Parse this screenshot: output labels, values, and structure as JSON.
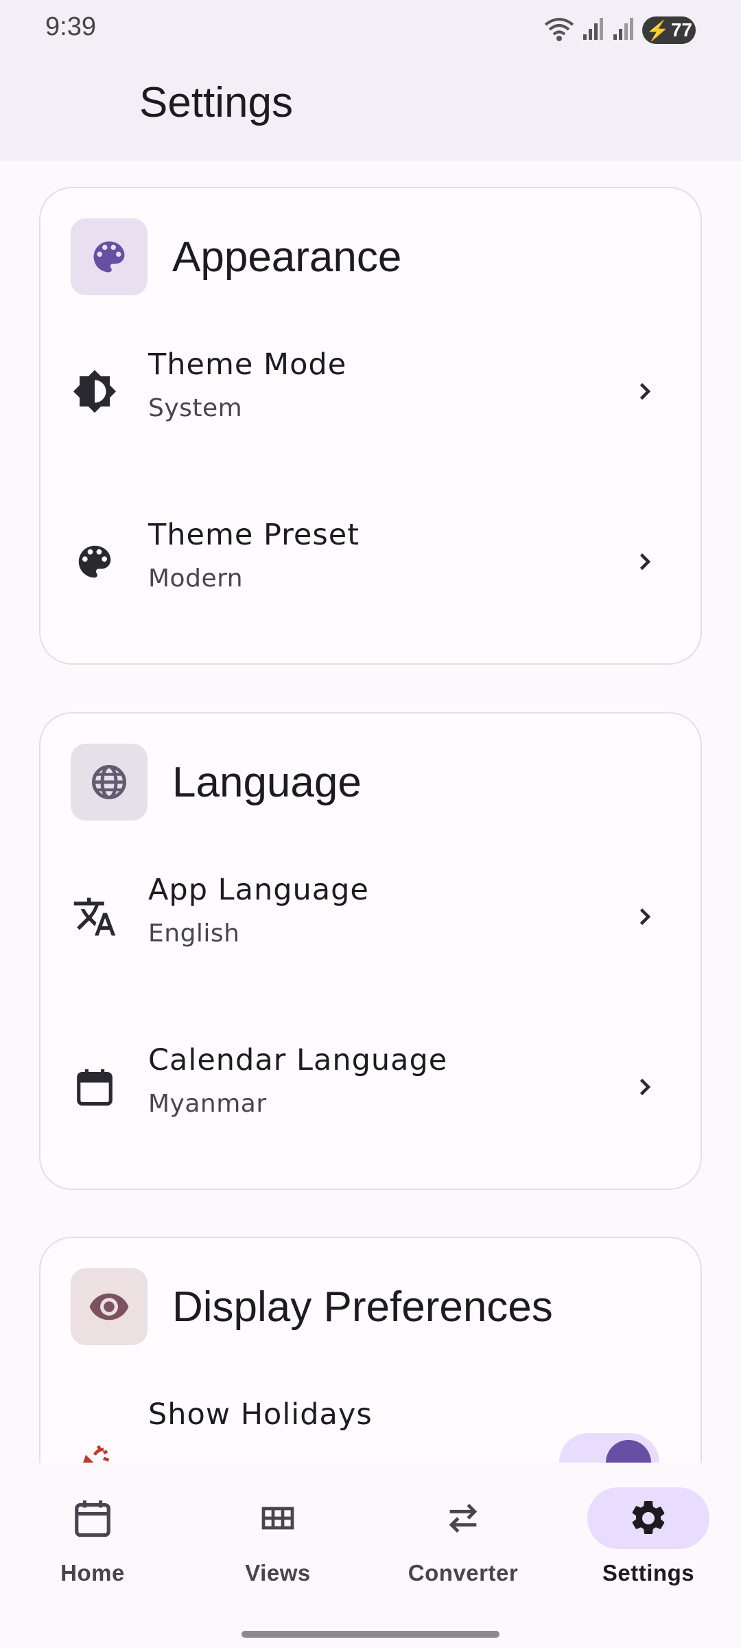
{
  "status": {
    "time": "9:39",
    "battery": "77"
  },
  "appbar": {
    "title": "Settings"
  },
  "sections": {
    "appearance": {
      "title": "Appearance",
      "icon": "palette-icon",
      "items": [
        {
          "title": "Theme Mode",
          "value": "System",
          "icon": "brightness-icon"
        },
        {
          "title": "Theme Preset",
          "value": "Modern",
          "icon": "palette-icon"
        }
      ]
    },
    "language": {
      "title": "Language",
      "icon": "globe-icon",
      "items": [
        {
          "title": "App Language",
          "value": "English",
          "icon": "translate-icon"
        },
        {
          "title": "Calendar Language",
          "value": "Myanmar",
          "icon": "calendar-icon"
        }
      ]
    },
    "display": {
      "title": "Display Preferences",
      "icon": "eye-icon",
      "items": [
        {
          "title": "Show Holidays",
          "icon": "celebration-icon",
          "enabled": true
        }
      ]
    }
  },
  "nav": {
    "items": [
      {
        "label": "Home",
        "icon": "calendar-icon",
        "active": false
      },
      {
        "label": "Views",
        "icon": "grid-icon",
        "active": false
      },
      {
        "label": "Converter",
        "icon": "swap-icon",
        "active": false
      },
      {
        "label": "Settings",
        "icon": "gear-icon",
        "active": true
      }
    ]
  },
  "colors": {
    "accent": "#6750a4",
    "accent_container": "#e9ddff",
    "card_border": "#e4dfe6",
    "holiday_red": "#c0392b"
  }
}
